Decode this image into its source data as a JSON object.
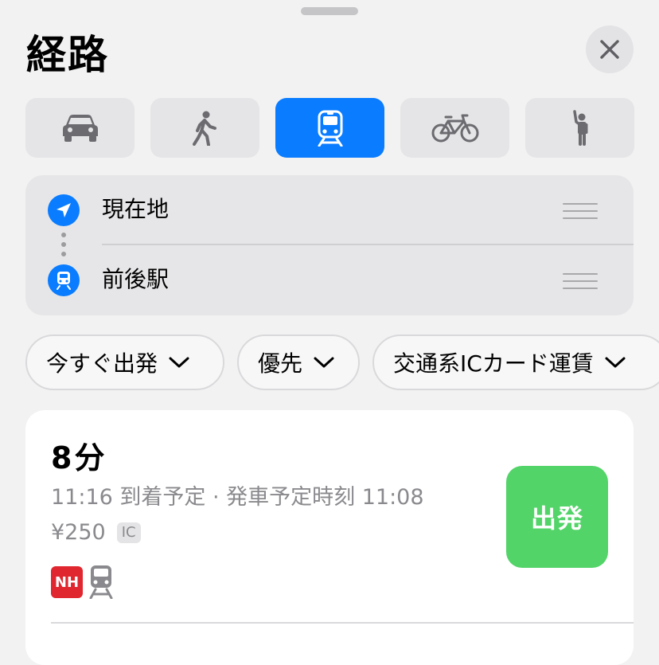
{
  "header": {
    "title": "経路"
  },
  "modes": [
    {
      "id": "car",
      "icon": "car-icon",
      "active": false
    },
    {
      "id": "walk",
      "icon": "walking-icon",
      "active": false
    },
    {
      "id": "transit",
      "icon": "train-icon",
      "active": true
    },
    {
      "id": "cycle",
      "icon": "bicycle-icon",
      "active": false
    },
    {
      "id": "rideshare",
      "icon": "hailing-person-icon",
      "active": false
    }
  ],
  "route": {
    "origin": "現在地",
    "destination": "前後駅"
  },
  "filters": {
    "depart": "今すぐ出発",
    "priority": "優先",
    "fare_type": "交通系ICカード運賃"
  },
  "result": {
    "duration": "8分",
    "times": "11:16 到着予定 · 発車予定時刻 11:08",
    "fare": "¥250",
    "fare_badge": "IC",
    "line_badge": "NH",
    "go_label": "出発"
  },
  "colors": {
    "accent": "#0a7cff",
    "go": "#52d468",
    "line_badge": "#e0262e"
  }
}
